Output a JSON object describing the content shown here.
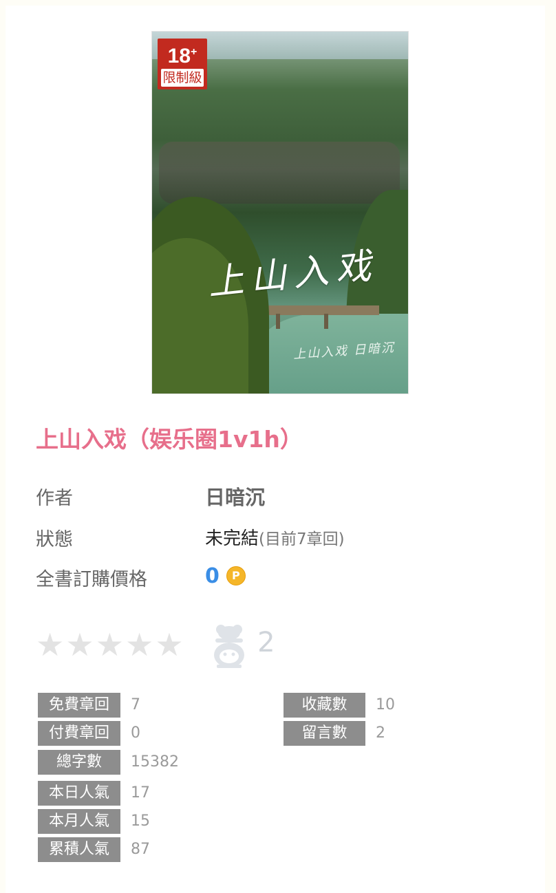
{
  "cover": {
    "badge_number": "18",
    "badge_plus": "+",
    "badge_text": "限制級",
    "title_art": "上山入戏",
    "author_art": "上山入戏 日暗沉"
  },
  "book": {
    "title": "上山入戏（娱乐圈1v1h）"
  },
  "info": {
    "author_label": "作者",
    "author_value": "日暗沉",
    "status_label": "狀態",
    "status_value": "未完結",
    "status_detail": "(目前7章回)",
    "price_label": "全書訂購價格",
    "price_value": "0",
    "coin_symbol": "P"
  },
  "rating": {
    "stars_total": 5,
    "stars_filled": 0,
    "rater_count": "2"
  },
  "stats": {
    "left": [
      {
        "label": "免費章回",
        "value": "7"
      },
      {
        "label": "付費章回",
        "value": "0"
      },
      {
        "label": "總字數",
        "value": "15382"
      },
      {
        "label": "本日人氣",
        "value": "17"
      },
      {
        "label": "本月人氣",
        "value": "15"
      },
      {
        "label": "累積人氣",
        "value": "87"
      }
    ],
    "right": [
      {
        "label": "收藏數",
        "value": "10"
      },
      {
        "label": "留言數",
        "value": "2"
      }
    ]
  },
  "colors": {
    "title": "#e76f8b",
    "price": "#3a8ee6",
    "label_bg": "#8d8d8d",
    "badge_red": "#c22a1f"
  }
}
